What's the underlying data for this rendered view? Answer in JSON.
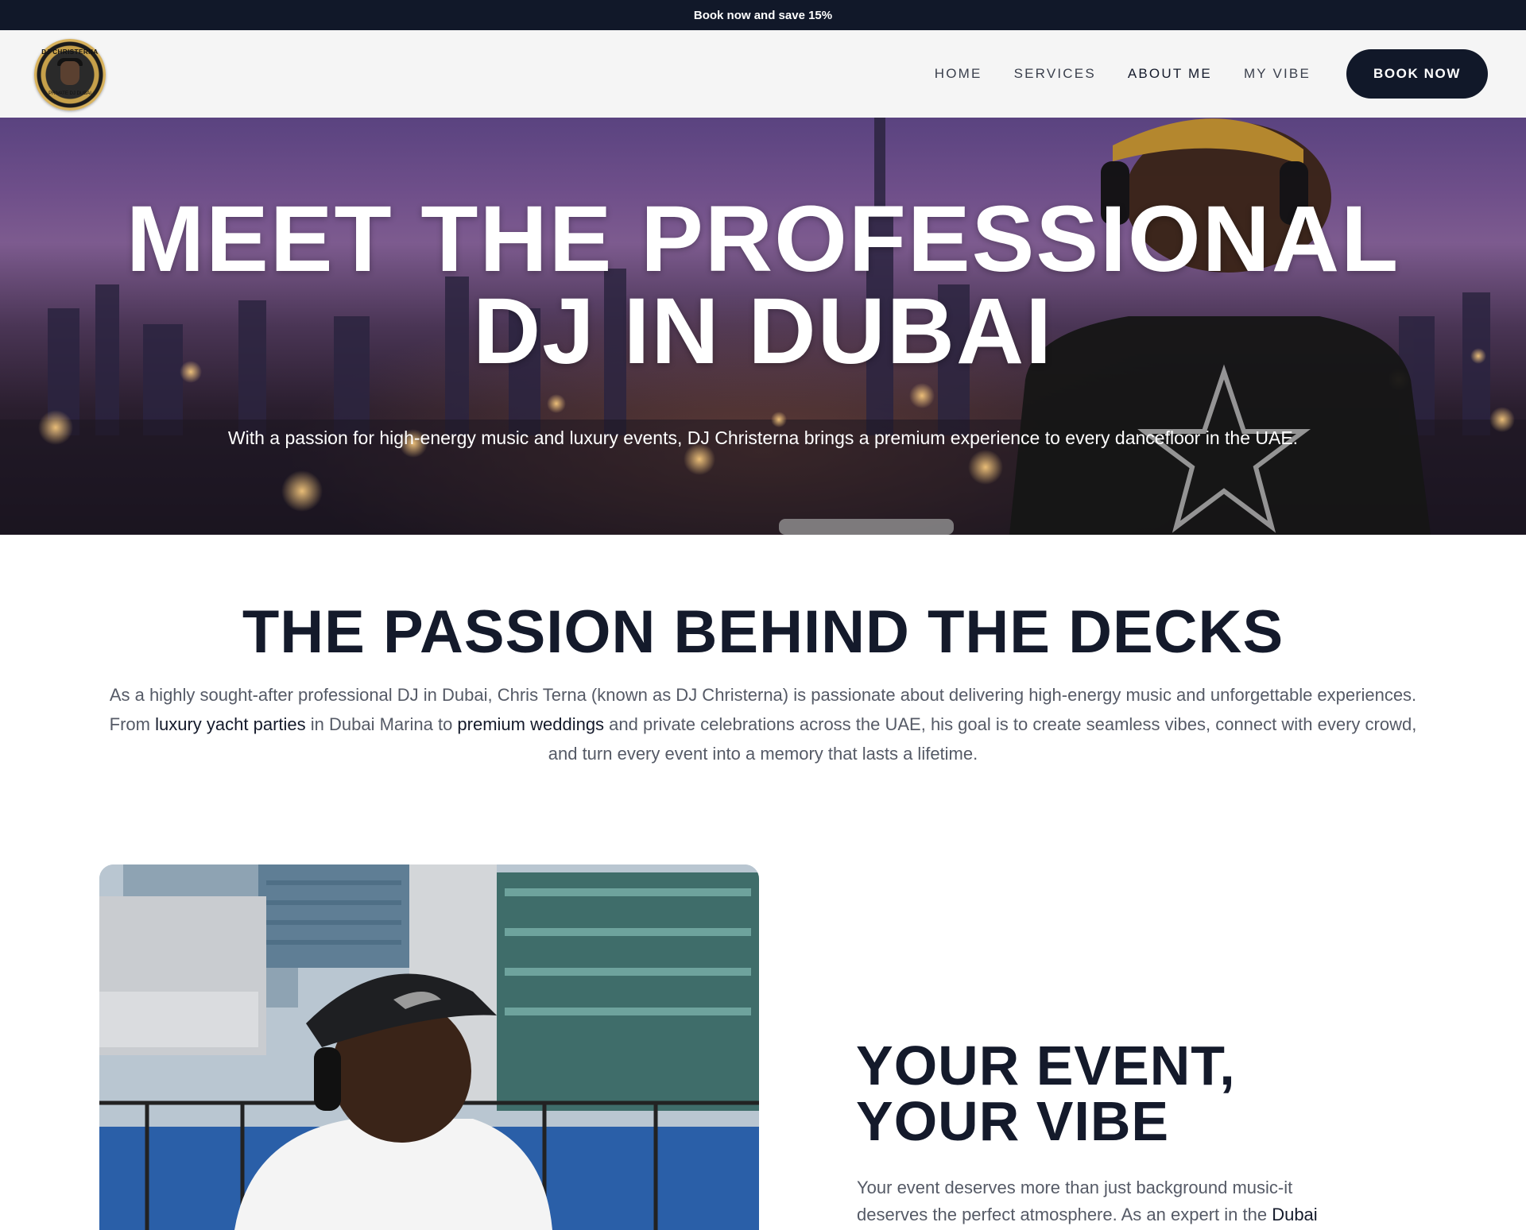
{
  "announcement": {
    "text": "Book now and save 15%"
  },
  "header": {
    "logo": {
      "top_text": "DJ CHRISTERNA",
      "bottom_text": "PRIVATE DJ DUBAI"
    },
    "nav": [
      {
        "label": "HOME"
      },
      {
        "label": "SERVICES"
      },
      {
        "label": "ABOUT ME"
      },
      {
        "label": "MY VIBE"
      }
    ],
    "book_button": "BOOK NOW"
  },
  "hero": {
    "title_line1": "MEET THE PROFESSIONAL",
    "title_line2": "DJ IN DUBAI",
    "subtitle": "With a passion for high-energy music and luxury events, DJ Christerna brings a premium experience to every dancefloor in the UAE."
  },
  "passion": {
    "title": "THE PASSION BEHIND THE DECKS",
    "body_part1": "As a highly sought-after professional DJ in Dubai, Chris Terna (known as DJ Christerna) is passionate about delivering high-energy music and unforgettable experiences. From ",
    "link1": "luxury yacht parties",
    "body_part2": " in Dubai Marina to ",
    "link2": "premium weddings",
    "body_part3": " and private celebrations across the UAE, his goal is to create seamless vibes, connect with every crowd, and turn every event into a memory that lasts a lifetime."
  },
  "event": {
    "title_line1": "YOUR EVENT,",
    "title_line2": "YOUR VIBE",
    "body_part1": "Your event deserves more than just background music-it deserves the perfect atmosphere. As an expert in the ",
    "link": "Dubai"
  },
  "colors": {
    "dark_navy": "#111829",
    "heading": "#141a2b",
    "body_text": "#555a66",
    "header_bg": "#f5f5f5"
  }
}
